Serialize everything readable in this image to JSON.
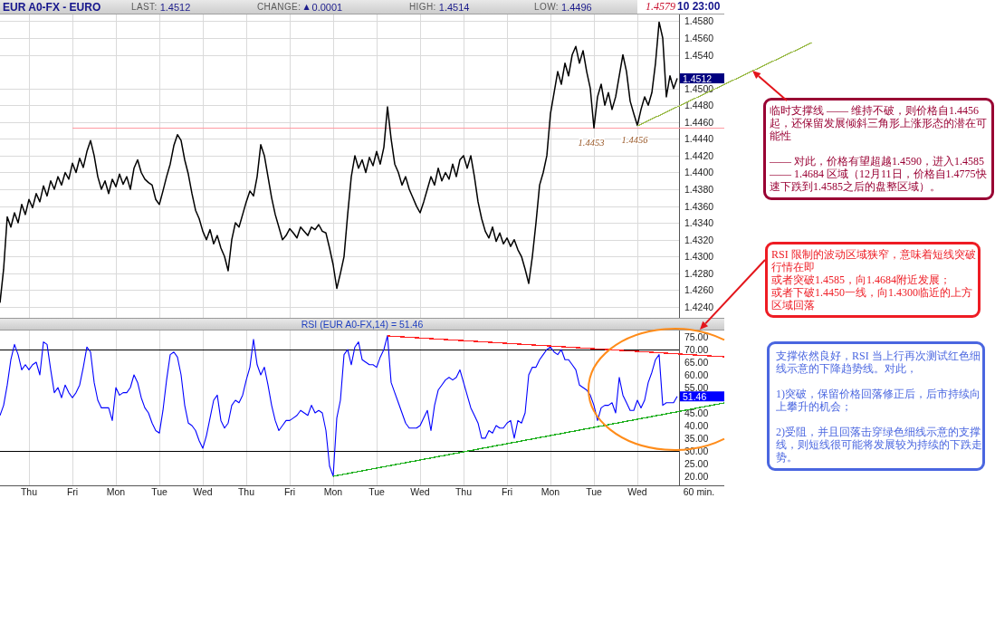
{
  "header": {
    "symbol": "EUR A0-FX - EURO",
    "stats": [
      {
        "label": "LAST:",
        "value": "1.4512"
      },
      {
        "label": "CHANGE:",
        "symbol": "▲",
        "value": "0.0001"
      },
      {
        "label": "HIGH:",
        "value": "1.4514"
      },
      {
        "label": "LOW:",
        "value": "1.4496"
      }
    ],
    "marker_price": "1.4579",
    "time": "10 23:00"
  },
  "price_chart": {
    "chart_data": {
      "type": "line",
      "grid": true,
      "categories": [
        null,
        null,
        null,
        null,
        null,
        null,
        null,
        null,
        null,
        null,
        null,
        null,
        null,
        null,
        null,
        null,
        null,
        null,
        null,
        null,
        null,
        null,
        null,
        null,
        null,
        null,
        null,
        null,
        null,
        null,
        null,
        null,
        null,
        null,
        null,
        null,
        null,
        null,
        null,
        null,
        null,
        null,
        null,
        null,
        null,
        null,
        null,
        null,
        null,
        null,
        null,
        null,
        null,
        null,
        null,
        null,
        null,
        null,
        null,
        null,
        null,
        null,
        null,
        null,
        null,
        null,
        null,
        null,
        null,
        null,
        null,
        null,
        null,
        null,
        null,
        null,
        null,
        null,
        null,
        null,
        null,
        null,
        null,
        null,
        null,
        null,
        null,
        null,
        null,
        null,
        null,
        null,
        null,
        null,
        null,
        null,
        null,
        null,
        null,
        null,
        null,
        null,
        null,
        null,
        null,
        null,
        null,
        null,
        null,
        null,
        null,
        null,
        null,
        null,
        null,
        null,
        null,
        null,
        null,
        null,
        null,
        null,
        null,
        null,
        null,
        null,
        null,
        null,
        null,
        null,
        null,
        null,
        null,
        null,
        null,
        null,
        null,
        null,
        null,
        null,
        null,
        null,
        null,
        null,
        null,
        null,
        null,
        null,
        null,
        null,
        null,
        null,
        null,
        null,
        null,
        null,
        null,
        null,
        null,
        null,
        null,
        null,
        null,
        null,
        null,
        null,
        null,
        null,
        null,
        null,
        null,
        null,
        null,
        null,
        null,
        null,
        null,
        null,
        null,
        null,
        null,
        null,
        null,
        null,
        null,
        null,
        null,
        null
      ],
      "series": [
        {
          "color": "#000000",
          "values": [
            1.4245,
            1.4285,
            1.4347,
            1.4335,
            1.4352,
            1.434,
            1.4362,
            1.435,
            1.4368,
            1.4358,
            1.4375,
            1.4365,
            1.4384,
            1.4372,
            1.439,
            1.438,
            1.4395,
            1.4385,
            1.44,
            1.4392,
            1.4411,
            1.44,
            1.4417,
            1.4406,
            1.4425,
            1.4438,
            1.442,
            1.4395,
            1.438,
            1.439,
            1.4375,
            1.4392,
            1.4383,
            1.4398,
            1.4386,
            1.4395,
            1.438,
            1.4405,
            1.4415,
            1.44,
            1.4392,
            1.4388,
            1.4385,
            1.4368,
            1.4362,
            1.4378,
            1.4395,
            1.441,
            1.4432,
            1.4445,
            1.4438,
            1.4415,
            1.4398,
            1.4375,
            1.4355,
            1.4345,
            1.433,
            1.432,
            1.4332,
            1.4315,
            1.4325,
            1.431,
            1.43,
            1.4283,
            1.432,
            1.434,
            1.4335,
            1.435,
            1.4365,
            1.4378,
            1.4372,
            1.4395,
            1.4433,
            1.442,
            1.4395,
            1.437,
            1.435,
            1.4335,
            1.432,
            1.4325,
            1.4333,
            1.4328,
            1.4322,
            1.4335,
            1.433,
            1.4325,
            1.4335,
            1.4332,
            1.4338,
            1.433,
            1.4328,
            1.431,
            1.429,
            1.4262,
            1.428,
            1.43,
            1.435,
            1.4395,
            1.442,
            1.4405,
            1.4415,
            1.44,
            1.4418,
            1.4408,
            1.4425,
            1.441,
            1.443,
            1.4478,
            1.444,
            1.441,
            1.44,
            1.4385,
            1.4395,
            1.438,
            1.437,
            1.436,
            1.4352,
            1.4365,
            1.438,
            1.4395,
            1.4385,
            1.4405,
            1.439,
            1.44,
            1.4392,
            1.441,
            1.4395,
            1.4415,
            1.442,
            1.4405,
            1.442,
            1.4395,
            1.4365,
            1.4345,
            1.433,
            1.4322,
            1.4335,
            1.4318,
            1.4328,
            1.4315,
            1.4322,
            1.4312,
            1.432,
            1.4308,
            1.43,
            1.4285,
            1.4268,
            1.43,
            1.434,
            1.4385,
            1.44,
            1.442,
            1.447,
            1.4495,
            1.452,
            1.4505,
            1.453,
            1.4515,
            1.454,
            1.455,
            1.453,
            1.4545,
            1.452,
            1.45,
            1.4453,
            1.449,
            1.4505,
            1.448,
            1.4495,
            1.4475,
            1.449,
            1.4515,
            1.454,
            1.452,
            1.4485,
            1.447,
            1.4456,
            1.4475,
            1.449,
            1.448,
            1.4495,
            1.453,
            1.4579,
            1.456,
            1.449,
            1.4515,
            1.45,
            1.4512
          ]
        }
      ],
      "ylim": [
        1.4227,
        1.4588
      ],
      "yticks": [
        {
          "value": 1.458,
          "label": "1.4580"
        },
        {
          "value": 1.456,
          "label": "1.4560"
        },
        {
          "value": 1.454,
          "label": "1.4540"
        },
        {
          "value": 1.45,
          "label": "1.4500"
        },
        {
          "value": 1.448,
          "label": "1.4480"
        },
        {
          "value": 1.446,
          "label": "1.4460"
        },
        {
          "value": 1.444,
          "label": "1.4440"
        },
        {
          "value": 1.442,
          "label": "1.4420"
        },
        {
          "value": 1.44,
          "label": "1.4400"
        },
        {
          "value": 1.438,
          "label": "1.4380"
        },
        {
          "value": 1.436,
          "label": "1.4360"
        },
        {
          "value": 1.434,
          "label": "1.4340"
        },
        {
          "value": 1.432,
          "label": "1.4320"
        },
        {
          "value": 1.43,
          "label": "1.4300"
        },
        {
          "value": 1.428,
          "label": "1.4280"
        },
        {
          "value": 1.426,
          "label": "1.4260"
        },
        {
          "value": 1.424,
          "label": "1.4240"
        }
      ],
      "ref_lines": [
        {
          "axis": "y",
          "value": 1.4453,
          "color": "#ff9aa2"
        }
      ],
      "annotations": [
        {
          "text": "1.4453",
          "y": 1.4453
        },
        {
          "text": "1.4456",
          "y": 1.4456
        },
        "1.4512"
      ]
    },
    "drawings": [
      {
        "kind": "trend_line",
        "color": "#9bbb4a"
      }
    ]
  },
  "rsi_chart": {
    "chart_data": {
      "type": "line",
      "grid": true,
      "title": "RSI (EUR A0-FX,14) = 51.46",
      "xlabel": "60 min.",
      "categories": [
        null,
        null,
        null,
        null,
        null,
        null,
        null,
        null,
        "Thu",
        null,
        null,
        null,
        null,
        null,
        null,
        null,
        null,
        null,
        null,
        null,
        "Fri",
        null,
        null,
        null,
        null,
        null,
        null,
        null,
        null,
        null,
        null,
        null,
        "Mon",
        null,
        null,
        null,
        null,
        null,
        null,
        null,
        null,
        null,
        null,
        null,
        "Tue",
        null,
        null,
        null,
        null,
        null,
        null,
        null,
        null,
        null,
        null,
        null,
        "Wed",
        null,
        null,
        null,
        null,
        null,
        null,
        null,
        null,
        null,
        null,
        null,
        "Thu",
        null,
        null,
        null,
        null,
        null,
        null,
        null,
        null,
        null,
        null,
        null,
        "Fri",
        null,
        null,
        null,
        null,
        null,
        null,
        null,
        null,
        null,
        null,
        null,
        "Mon",
        null,
        null,
        null,
        null,
        null,
        null,
        null,
        null,
        null,
        null,
        null,
        "Tue",
        null,
        null,
        null,
        null,
        null,
        null,
        null,
        null,
        null,
        null,
        null,
        "Wed",
        null,
        null,
        null,
        null,
        null,
        null,
        null,
        null,
        null,
        null,
        null,
        "Thu",
        null,
        null,
        null,
        null,
        null,
        null,
        null,
        null,
        null,
        null,
        null,
        "Fri",
        null,
        null,
        null,
        null,
        null,
        null,
        null,
        null,
        null,
        null,
        null,
        "Mon",
        null,
        null,
        null,
        null,
        null,
        null,
        null,
        null,
        null,
        null,
        null,
        "Tue",
        null,
        null,
        null,
        null,
        null,
        null,
        null,
        null,
        null,
        null,
        null,
        "Wed",
        null,
        null,
        null,
        null,
        null,
        null,
        null,
        null,
        null,
        null,
        null
      ],
      "series": [
        {
          "color": "#0000ff",
          "values": [
            44,
            48,
            56,
            66,
            72,
            68,
            62,
            64,
            62,
            64,
            65,
            60,
            73,
            72,
            62,
            53,
            55,
            51,
            56,
            53,
            51,
            53,
            56,
            63,
            71,
            69,
            57,
            50,
            47,
            47,
            47,
            42,
            55,
            52,
            53,
            53,
            55,
            60,
            57,
            51,
            47,
            45,
            41,
            38,
            37,
            46,
            58,
            68,
            69,
            67,
            60,
            48,
            41,
            40,
            38,
            34,
            31,
            36,
            43,
            50,
            52,
            42,
            39,
            41,
            48,
            50,
            49,
            52,
            58,
            63,
            74,
            64,
            60,
            63,
            56,
            48,
            42,
            38,
            40,
            42,
            42,
            43,
            44,
            46,
            45,
            44,
            48,
            45,
            46,
            45,
            38,
            24,
            20,
            43,
            50,
            68,
            70,
            64,
            71,
            73,
            66,
            65,
            64,
            64,
            63,
            67,
            70,
            75.5,
            57,
            53,
            49,
            45,
            41,
            39,
            39,
            39,
            40,
            43,
            46,
            38,
            48,
            54,
            56,
            58,
            59,
            58,
            59,
            62,
            57,
            52,
            47,
            44,
            41,
            35,
            35,
            38,
            37,
            40,
            39,
            39,
            41,
            42,
            35,
            42,
            41,
            45,
            60,
            63,
            63,
            66,
            68,
            70,
            71,
            69,
            68,
            70,
            66,
            66,
            64,
            62,
            56,
            55,
            54,
            52,
            48,
            42,
            47,
            48,
            48,
            49,
            45,
            59,
            52,
            49,
            46,
            46,
            50,
            47,
            50,
            57,
            61,
            66,
            68,
            48,
            49,
            49,
            49,
            51.5
          ]
        }
      ],
      "ylim": [
        16.4,
        77.5
      ],
      "yticks": [
        {
          "value": 75,
          "label": "75.00"
        },
        {
          "value": 70,
          "label": "70.00"
        },
        {
          "value": 65,
          "label": "65.00"
        },
        {
          "value": 60,
          "label": "60.00"
        },
        {
          "value": 55,
          "label": "55.00"
        },
        {
          "value": 45,
          "label": "45.00"
        },
        {
          "value": 40,
          "label": "40.00"
        },
        {
          "value": 35,
          "label": "35.00"
        },
        {
          "value": 30,
          "label": "30.00"
        },
        {
          "value": 25,
          "label": "25.00"
        },
        {
          "value": 20,
          "label": "20.00"
        }
      ],
      "ref_lines": [
        {
          "axis": "y",
          "value": 70,
          "color": "#000000"
        },
        {
          "axis": "y",
          "value": 30,
          "color": "#000000"
        }
      ],
      "annotations": [
        "51.46"
      ]
    },
    "drawings": [
      {
        "kind": "trend_line",
        "color": "#ff2020"
      },
      {
        "kind": "trend_line",
        "color": "#20b020"
      },
      {
        "kind": "ellipse",
        "color": "#ff8c1a"
      }
    ]
  },
  "callouts": [
    {
      "color": "#990033",
      "arrow": true,
      "paragraphs": [
        "临时支撑线 —— 维持不破，则价格自1.4456起，还保留发展倾斜三角形上涨形态的潜在可能性",
        "—— 对此，价格有望超越1.4590，进入1.4585 —— 1.4684 区域（12月11日，价格自1.4775快速下跌到1.4585之后的盘整区域）。"
      ]
    },
    {
      "color": "#ee1c24",
      "arrow": true,
      "paragraphs": [
        "RSI 限制的波动区域狭窄，意味着短线突破行情在即",
        "或者突破1.4585，向1.4684附近发展；",
        "或者下破1.4450一线，向1.4300临近的上方区域回落"
      ]
    },
    {
      "color": "#4a66e0",
      "arrow": false,
      "paragraphs": [
        "支撑依然良好，RSI 当上行再次测试红色细线示意的下降趋势线。对此，",
        "1)突破，保留价格回落修正后，后市持续向上攀升的机会；",
        "2)受阻，并且回落击穿绿色细线示意的支撑线，则短线很可能将发展较为持续的下跌走势。"
      ]
    }
  ]
}
